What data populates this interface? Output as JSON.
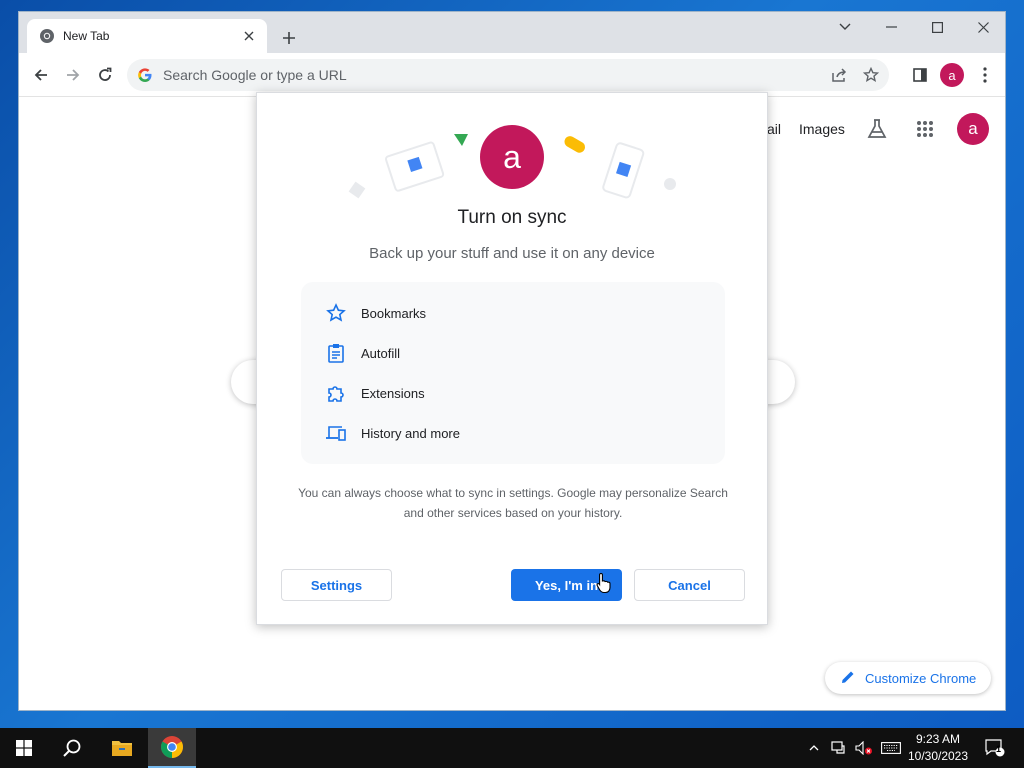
{
  "browser": {
    "tab_title": "New Tab",
    "omnibox_placeholder": "Search Google or type a URL",
    "profile_initial": "a"
  },
  "ntp": {
    "gmail_link": "ail",
    "images_link": "Images",
    "profile_initial": "a",
    "customize_label": "Customize Chrome"
  },
  "dialog": {
    "avatar_initial": "a",
    "title": "Turn on sync",
    "subtitle": "Back up your stuff and use it on any device",
    "features": [
      {
        "label": "Bookmarks",
        "icon": "star-icon"
      },
      {
        "label": "Autofill",
        "icon": "clipboard-icon"
      },
      {
        "label": "Extensions",
        "icon": "puzzle-icon"
      },
      {
        "label": "History and more",
        "icon": "devices-icon"
      }
    ],
    "note": "You can always choose what to sync in settings. Google may personalize Search and other services based on your history.",
    "settings_button": "Settings",
    "confirm_button": "Yes, I'm in",
    "cancel_button": "Cancel"
  },
  "taskbar": {
    "time": "9:23 AM",
    "date": "10/30/2023",
    "notification_count": "1"
  },
  "colors": {
    "accent": "#1a73e8",
    "avatar": "#c2185b",
    "taskbar": "#101010"
  }
}
